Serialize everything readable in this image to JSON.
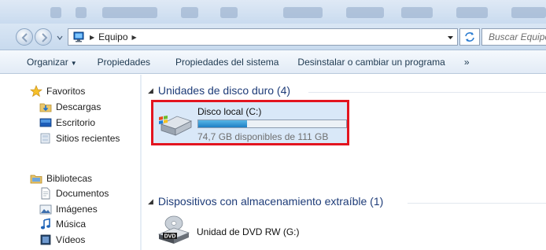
{
  "address_bar": {
    "breadcrumb": [
      "Equipo"
    ],
    "search_placeholder": "Buscar Equipo"
  },
  "toolbar": {
    "organize": "Organizar",
    "properties": "Propiedades",
    "system_properties": "Propiedades del sistema",
    "uninstall": "Desinstalar o cambiar un programa",
    "more": "»"
  },
  "nav": {
    "favorites": {
      "label": "Favoritos",
      "items": [
        {
          "label": "Descargas",
          "icon": "downloads-folder-icon"
        },
        {
          "label": "Escritorio",
          "icon": "desktop-icon"
        },
        {
          "label": "Sitios recientes",
          "icon": "recent-places-icon"
        }
      ]
    },
    "libraries": {
      "label": "Bibliotecas",
      "items": [
        {
          "label": "Documentos",
          "icon": "documents-icon"
        },
        {
          "label": "Imágenes",
          "icon": "pictures-icon"
        },
        {
          "label": "Música",
          "icon": "music-icon"
        },
        {
          "label": "Vídeos",
          "icon": "videos-icon"
        }
      ]
    }
  },
  "content": {
    "hard_drives_header": "Unidades de disco duro (4)",
    "removable_header": "Dispositivos con almacenamiento extraíble (1)",
    "local_disk": {
      "name": "Disco local (C:)",
      "free_text": "74,7 GB disponibles de 111 GB",
      "used_fraction": 0.33
    },
    "dvd_drive": {
      "name": "Unidad de DVD RW (G:)",
      "icon_text": "DVD"
    }
  },
  "colors": {
    "highlight_border": "#e3141f",
    "selection_fill": "#d9e8f8",
    "group_header": "#1e3c78",
    "usage_bar": "#1e7fc4"
  }
}
